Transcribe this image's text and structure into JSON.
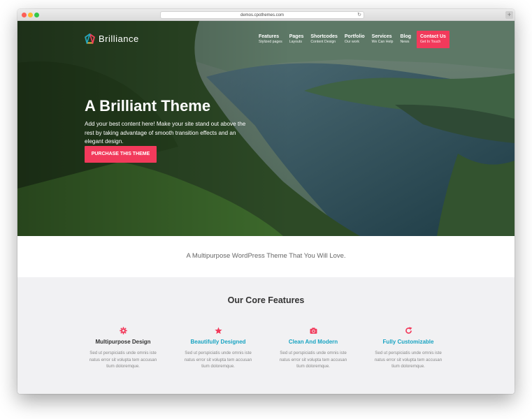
{
  "browser": {
    "url": "demos.cpothemes.com"
  },
  "site": {
    "logo_text": "Brilliance"
  },
  "nav": {
    "items": [
      {
        "label": "Features",
        "sub": "Stylized pages"
      },
      {
        "label": "Pages",
        "sub": "Layouts"
      },
      {
        "label": "Shortcodes",
        "sub": "Content Design"
      },
      {
        "label": "Portfolio",
        "sub": "Our work"
      },
      {
        "label": "Services",
        "sub": "We Can Help"
      },
      {
        "label": "Blog",
        "sub": "News"
      }
    ],
    "cta": {
      "label": "Contact Us",
      "sub": "Get In Touch"
    }
  },
  "hero": {
    "title": "A Brilliant Theme",
    "description": "Add your best content here! Make your site stand out above the rest by taking advantage of smooth transition effects and an elegant design.",
    "button": "PURCHASE THIS THEME"
  },
  "tagline": "A Multipurpose WordPress Theme That You Will Love.",
  "features": {
    "title": "Our Core Features",
    "items": [
      {
        "icon": "gear-icon",
        "name": "Multipurpose Design",
        "text": "Sed ut perspiciatis unde omnis iste natus error sit volupta tem accusan tium doloremque."
      },
      {
        "icon": "star-icon",
        "name": "Beautifully Designed",
        "text": "Sed ut perspiciatis unde omnis iste natus error sit volupta tem accusan tium doloremque."
      },
      {
        "icon": "camera-icon",
        "name": "Clean And Modern",
        "text": "Sed ut perspiciatis unde omnis iste natus error sit volupta tem accusan tium doloremque."
      },
      {
        "icon": "refresh-icon",
        "name": "Fully Customizable",
        "text": "Sed ut perspiciatis unde omnis iste natus error sit volupta tem accusan tium doloremque."
      }
    ]
  },
  "colors": {
    "accent": "#f23a5b",
    "highlight": "#19a4c2",
    "features_bg": "#f1f1f3"
  }
}
